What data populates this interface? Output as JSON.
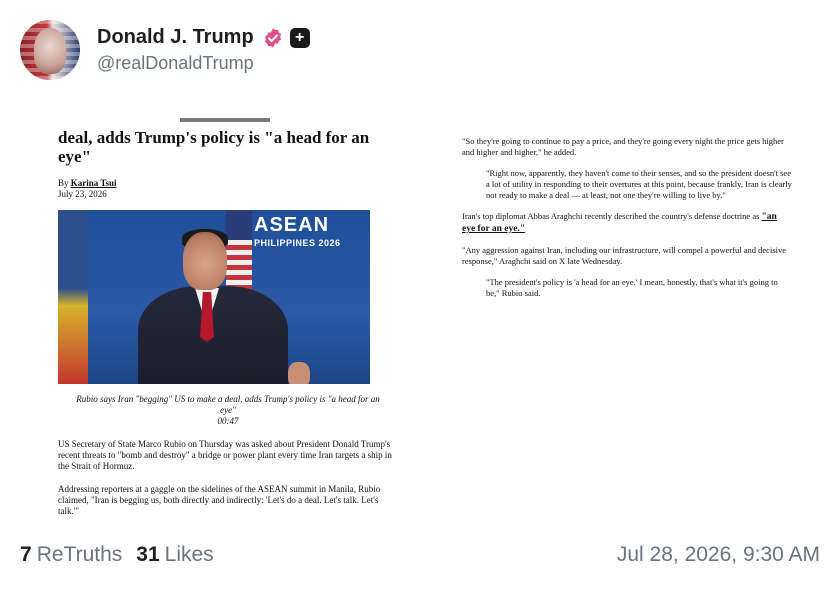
{
  "post": {
    "author_name": "Donald J. Trump",
    "author_handle": "@realDonaldTrump",
    "plus_badge": "+",
    "retruths_count": "7",
    "retruths_label": "ReTruths",
    "likes_count": "31",
    "likes_label": "Likes",
    "timestamp": "Jul 28, 2026, 9:30 AM"
  },
  "article": {
    "headline": "deal, adds Trump's policy is \"a head for an eye\"",
    "byline_prefix": "By",
    "byline_author": "Karina Tsui",
    "date": "July 23, 2026",
    "photo_banner_big": "ASEAN",
    "photo_banner_small": "PHILIPPINES 2026",
    "caption": "Rubio says Iran \"begging\" US to make a deal, adds Trump's policy is \"a head for an eye\"",
    "caption_duration": "00:47",
    "paragraph_1": "US Secretary of State Marco Rubio on Thursday was asked about President Donald Trump's recent threats to \"bomb and destroy\" a bridge or power plant every time Iran targets a ship in the Strait of Hormuz.",
    "paragraph_2": "Addressing reporters at a gaggle on the sidelines of the ASEAN summit in Manila, Rubio claimed, \"Iran is begging us, both directly and indirectly: 'Let's do a deal. Let's talk. Let's talk.'\"",
    "right_1": "\"So they're going to continue to pay a price, and they're going every night the price gets higher and higher and higher,\" he added.",
    "right_2": "\"Right now, apparently, they haven't come to their senses, and so the president doesn't see a lot of utility in responding to their overtures at this point, because frankly, Iran is clearly not ready to make a deal — at least, not one they're willing to live by.\"",
    "right_3_prefix": "Iran's top diplomat Abbas Araghchi recently described the country's defense doctrine as ",
    "right_3_link": "\"an eye for an eye.\"",
    "right_4": "\"Any aggression against Iran, including our infrastructure, will compel a powerful and decisive response,\" Araghchi said on X late Wednesday.",
    "right_5": "\"The president's policy is 'a head for an eye.' I mean, honestly, that's what it's going to be,\" Rubio said."
  },
  "colors": {
    "verified_badge": "#e0508c",
    "muted_text": "#6b7280"
  },
  "icons": {
    "verified": "verified-badge-icon",
    "plus": "plus-badge-icon"
  }
}
